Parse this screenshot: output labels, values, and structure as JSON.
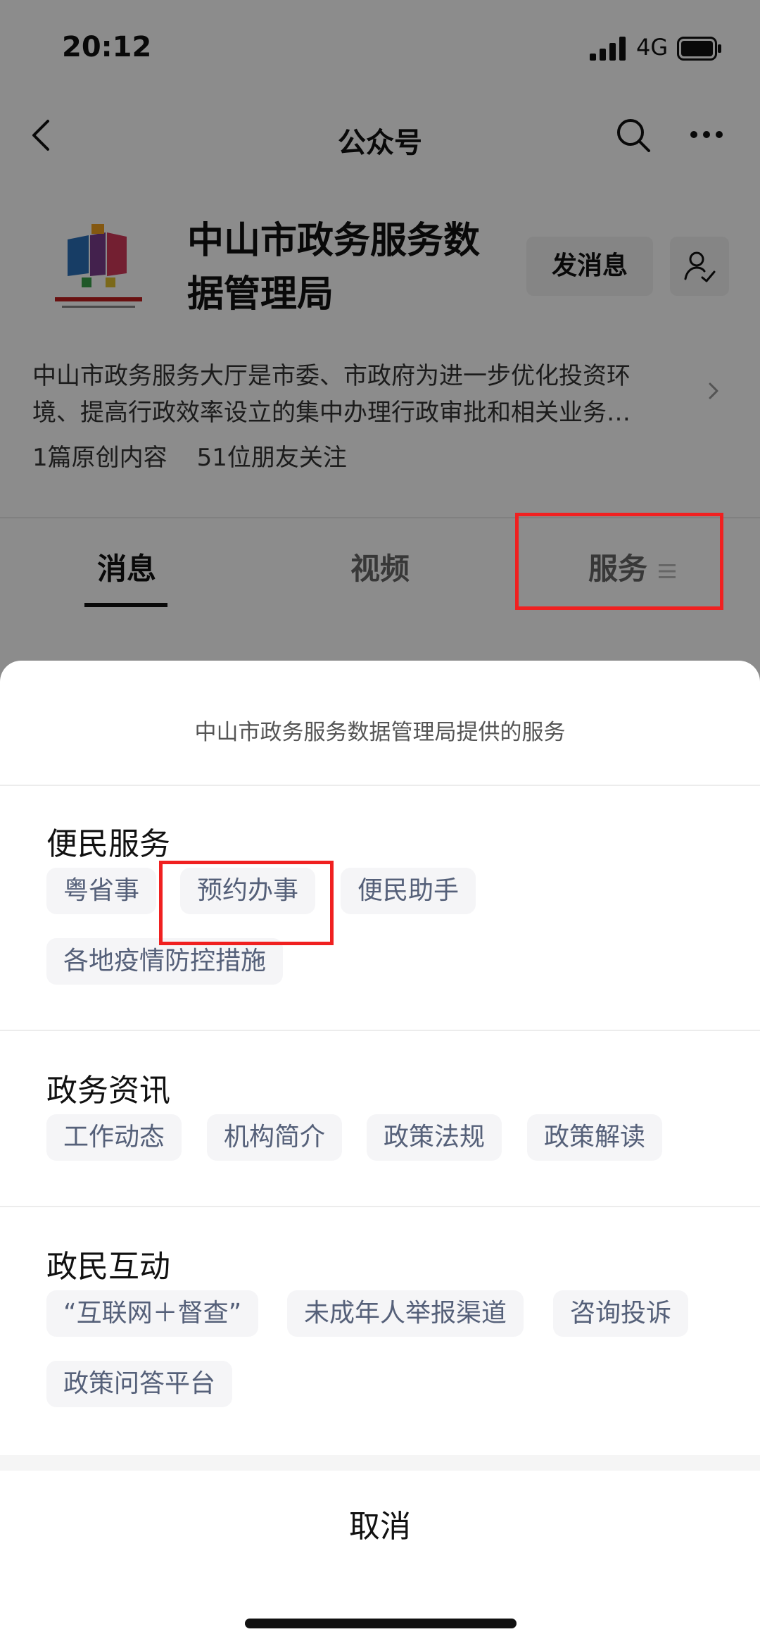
{
  "status_bar": {
    "time": "20:12",
    "network": "4G"
  },
  "nav": {
    "title": "公众号"
  },
  "profile": {
    "name_line1": "中山市政务服务数",
    "name_line2": "据管理局",
    "send_message": "发消息",
    "description_line1": "中山市政务服务大厅是市委、市政府为进一步优化投资环",
    "description_line2": "境、提高行政效率设立的集中办理行政审批和相关业务…",
    "original_count": "1篇原创内容",
    "followers": "51位朋友关注"
  },
  "tabs": {
    "messages": "消息",
    "videos": "视频",
    "services": "服务"
  },
  "sheet": {
    "title": "中山市政务服务数据管理局提供的服务",
    "sections": [
      {
        "title": "便民服务",
        "items": [
          "粤省事",
          "预约办事",
          "便民助手",
          "各地疫情防控措施"
        ]
      },
      {
        "title": "政务资讯",
        "items": [
          "工作动态",
          "机构简介",
          "政策法规",
          "政策解读"
        ]
      },
      {
        "title": "政民互动",
        "items": [
          "“互联网＋督查”",
          "未成年人举报渠道",
          "咨询投诉",
          "政策问答平台"
        ]
      }
    ],
    "cancel": "取消"
  },
  "colors": {
    "highlight": "#f02020",
    "chip_text": "#556079",
    "chip_bg": "#f5f5f7"
  }
}
